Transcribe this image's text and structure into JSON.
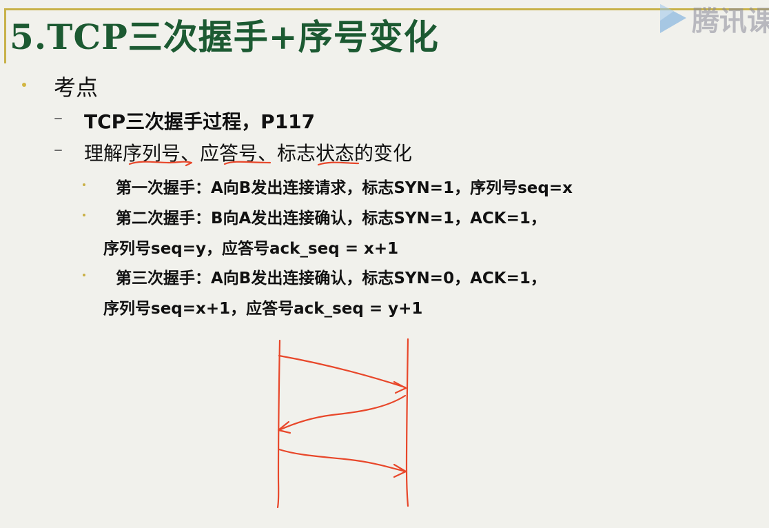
{
  "title": "5.TCP三次握手+序号变化",
  "logo": {
    "brand": "腾讯课",
    "icon": "play-icon",
    "color": "#4a8ed0"
  },
  "bullets": {
    "level1": "考点",
    "level2_a": "TCP三次握手过程，P117",
    "level2_b": "理解序列号、应答号、标志状态的变化",
    "steps": [
      {
        "line1": "第一次握手：A向B发出连接请求，标志SYN=1，序列号seq=x",
        "line2": ""
      },
      {
        "line1": "第二次握手：B向A发出连接确认，标志SYN=1，ACK=1，",
        "line2": "序列号seq=y，应答号ack_seq = x+1"
      },
      {
        "line1": "第三次握手：A向B发出连接确认，标志SYN=0，ACK=1，",
        "line2": "序列号seq=x+1，应答号ack_seq = y+1"
      }
    ]
  },
  "colors": {
    "title": "#1c5a32",
    "ink": "#e8472a",
    "bullet": "#d2b642"
  }
}
